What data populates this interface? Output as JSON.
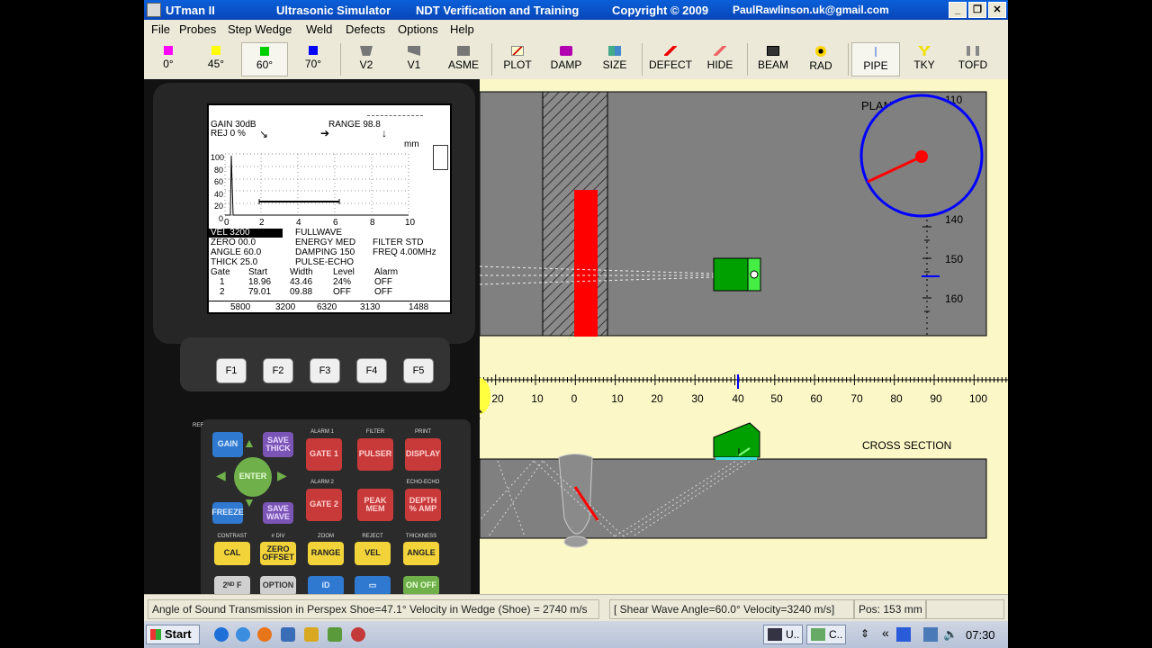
{
  "window": {
    "app_name": "UTman II",
    "title_sim": "Ultrasonic Simulator",
    "title_ndt": "NDT Verification and Training",
    "title_copyright": "Copyright © 2009",
    "title_email": "PaulRawlinson.uk@gmail.com",
    "min_glyph": "_",
    "max_glyph": "❐",
    "close_glyph": "✕"
  },
  "menu": [
    "File",
    "Probes",
    "Step Wedge",
    "Weld",
    "Defects",
    "Options",
    "Help"
  ],
  "toolbar": [
    {
      "label": "0°",
      "icon": "magenta-square-icon",
      "color": "#ff00ff"
    },
    {
      "label": "45°",
      "icon": "yellow-square-icon",
      "color": "#ffff00"
    },
    {
      "label": "60°",
      "icon": "green-square-icon",
      "color": "#00d000",
      "pressed": true
    },
    {
      "label": "70°",
      "icon": "blue-square-icon",
      "color": "#0000ff"
    },
    {
      "label": "V2",
      "icon": "v2-block-icon"
    },
    {
      "label": "V1",
      "icon": "v1-block-icon"
    },
    {
      "label": "ASME",
      "icon": "asme-block-icon"
    },
    {
      "label": "PLOT",
      "icon": "plot-icon"
    },
    {
      "label": "DAMP",
      "icon": "damp-icon"
    },
    {
      "label": "SIZE",
      "icon": "size-icon"
    },
    {
      "label": "DEFECT",
      "icon": "defect-icon"
    },
    {
      "label": "HIDE",
      "icon": "hide-icon"
    },
    {
      "label": "BEAM",
      "icon": "beam-icon"
    },
    {
      "label": "RAD",
      "icon": "radiation-icon"
    },
    {
      "label": "PIPE",
      "icon": "pipe-icon",
      "pressed": true
    },
    {
      "label": "TKY",
      "icon": "tky-icon"
    },
    {
      "label": "TOFD",
      "icon": "tofd-icon"
    }
  ],
  "device": {
    "screen": {
      "gain": "GAIN  30dB",
      "rej": "REJ 0 %",
      "range": "RANGE 98.8",
      "unit": "mm",
      "y_ticks": [
        "100",
        "80",
        "60",
        "40",
        "20",
        "0"
      ],
      "x_ticks": [
        "0",
        "2",
        "4",
        "6",
        "8",
        "10"
      ],
      "vel": "VEL  3200",
      "fullwave": "FULLWAVE",
      "zero": "ZERO   00.0",
      "energy": "ENERGY MED",
      "filter": "FILTER STD",
      "angle": "ANGLE  60.0",
      "damping": "DAMPING 150",
      "freq": "FREQ 4.00MHz",
      "thick": "THICK  25.0",
      "mode": "PULSE-ECHO",
      "gate_headers": [
        "Gate",
        "Start",
        "Width",
        "Level",
        "Alarm"
      ],
      "gates": [
        [
          "1",
          "18.96",
          "43.46",
          "24%",
          "OFF"
        ],
        [
          "2",
          "79.01",
          "09.88",
          "OFF",
          "OFF"
        ]
      ],
      "velocities": [
        "5800",
        "3200",
        "6320",
        "3130",
        "1488"
      ]
    },
    "fkeys": [
      "F1",
      "F2",
      "F3",
      "F4",
      "F5"
    ],
    "keys": {
      "gain": "GAIN",
      "save_thick": "SAVE THICK",
      "enter": "ENTER",
      "freeze": "FREEZE",
      "save_wave": "SAVE WAVE",
      "ref": "REF",
      "alarm1": "ALARM 1",
      "gate1": "GATE 1",
      "alarm2": "ALARM 2",
      "gate2": "GATE 2",
      "filter": "FILTER",
      "pulser": "PULSER",
      "print": "PRINT",
      "display": "DISPLAY",
      "peak_mem": "PEAK MEM",
      "echo_echo": "ECHO-ECHO",
      "depth_amp": "DEPTH % AMP",
      "contrast": "CONTRAST",
      "cal": "CAL",
      "div": "# DIV",
      "zero_offset": "ZERO OFFSET",
      "zoom": "ZOOM",
      "range": "RANGE",
      "reject": "REJECT",
      "vel": "VEL",
      "thickness": "THICKNESS",
      "angle": "ANGLE",
      "second_f": "2ᴺᴰ F",
      "option": "OPTION",
      "id": "iD",
      "on_off": "ON OFF"
    }
  },
  "sim": {
    "plan_label": "PLAN",
    "cross_section_label": "CROSS SECTION",
    "dial_ticks": [
      "110",
      "140",
      "150",
      "160"
    ],
    "ruler_ticks": [
      "20",
      "10",
      "0",
      "10",
      "20",
      "30",
      "40",
      "50",
      "60",
      "70",
      "80",
      "90",
      "100"
    ]
  },
  "status": {
    "transmission": "Angle of Sound Transmission in Perspex Shoe=47.1°  Velocity in Wedge (Shoe) = 2740 m/s",
    "shear": "[ Shear Wave Angle=60.0°   Velocity=3240 m/s]",
    "pos": "Pos: 153 mm"
  },
  "taskbar": {
    "start": "Start",
    "task1": "U..",
    "task2": "C..",
    "clock": "07:30",
    "chevron": "«"
  },
  "colors": {
    "title": "#0a5fd8",
    "sim_bg": "#fbf7c6",
    "steel": "#808080",
    "defect_red": "#ff0000",
    "probe_green": "#00a000",
    "dial_blue": "#0000ff"
  }
}
